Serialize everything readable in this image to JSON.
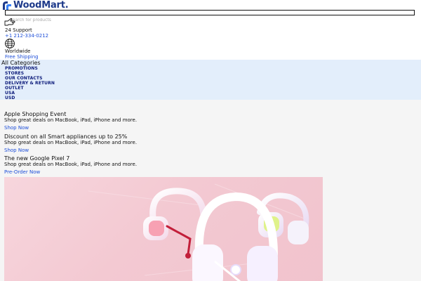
{
  "brand": {
    "name": "WoodMart.",
    "accent_color": "#1e3a8a"
  },
  "search": {
    "placeholder": "Search for products"
  },
  "support": {
    "icon": "support-hand-icon",
    "title": "24 Support",
    "phone": "+1 212-334-0212"
  },
  "shipping": {
    "icon": "globe-icon",
    "title": "Worldwide",
    "link_label": "Free Shipping"
  },
  "nav": {
    "all_categories": "All Categories",
    "items": [
      "PROMOTIONS",
      "STORES",
      "OUR CONTACTS",
      "DELIVERY & RETURN",
      "OUTLET",
      "USA",
      "USD"
    ]
  },
  "promos": [
    {
      "title": "Apple Shopping Event",
      "desc": "Shop great deals on MacBook, iPad, iPhone and more.",
      "link": "Shop Now"
    },
    {
      "title": "Discount on all Smart appliances up to 25%",
      "desc": "Shop great deals on MacBook, iPad, iPhone and more.",
      "link": "Shop Now"
    },
    {
      "title": "The new Google Pixel 7",
      "desc": "Shop great deals on MacBook, iPad, iPhone and more.",
      "link": "Pre-Order Now"
    }
  ],
  "hero": {
    "image": "pink-headphones-product-image"
  },
  "colors": {
    "link": "#1d4ed8",
    "nav_bg": "#e3eefb",
    "nav_text": "#0b1a7a",
    "hero_bg": "#f3c9d2"
  }
}
